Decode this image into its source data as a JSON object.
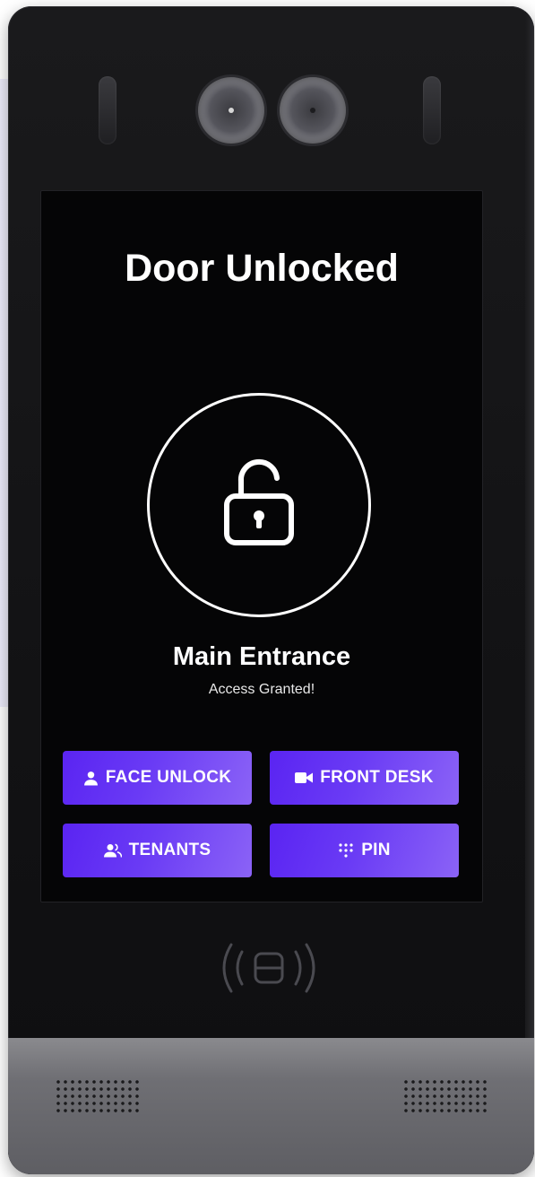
{
  "screen": {
    "title": "Door Unlocked",
    "location": "Main Entrance",
    "status": "Access Granted!"
  },
  "buttons": {
    "face_unlock": {
      "label": "FACE UNLOCK",
      "icon": "person-icon"
    },
    "front_desk": {
      "label": "FRONT DESK",
      "icon": "video-camera-icon"
    },
    "tenants": {
      "label": "TENANTS",
      "icon": "group-icon"
    },
    "pin": {
      "label": "PIN",
      "icon": "keypad-icon"
    }
  },
  "icons": {
    "status": "unlocked-padlock-icon",
    "reader": "nfc-reader-icon"
  },
  "colors": {
    "button_gradient_start": "#5a24f2",
    "button_gradient_end": "#8b63f6",
    "screen_background": "#050506",
    "text": "#ffffff"
  }
}
